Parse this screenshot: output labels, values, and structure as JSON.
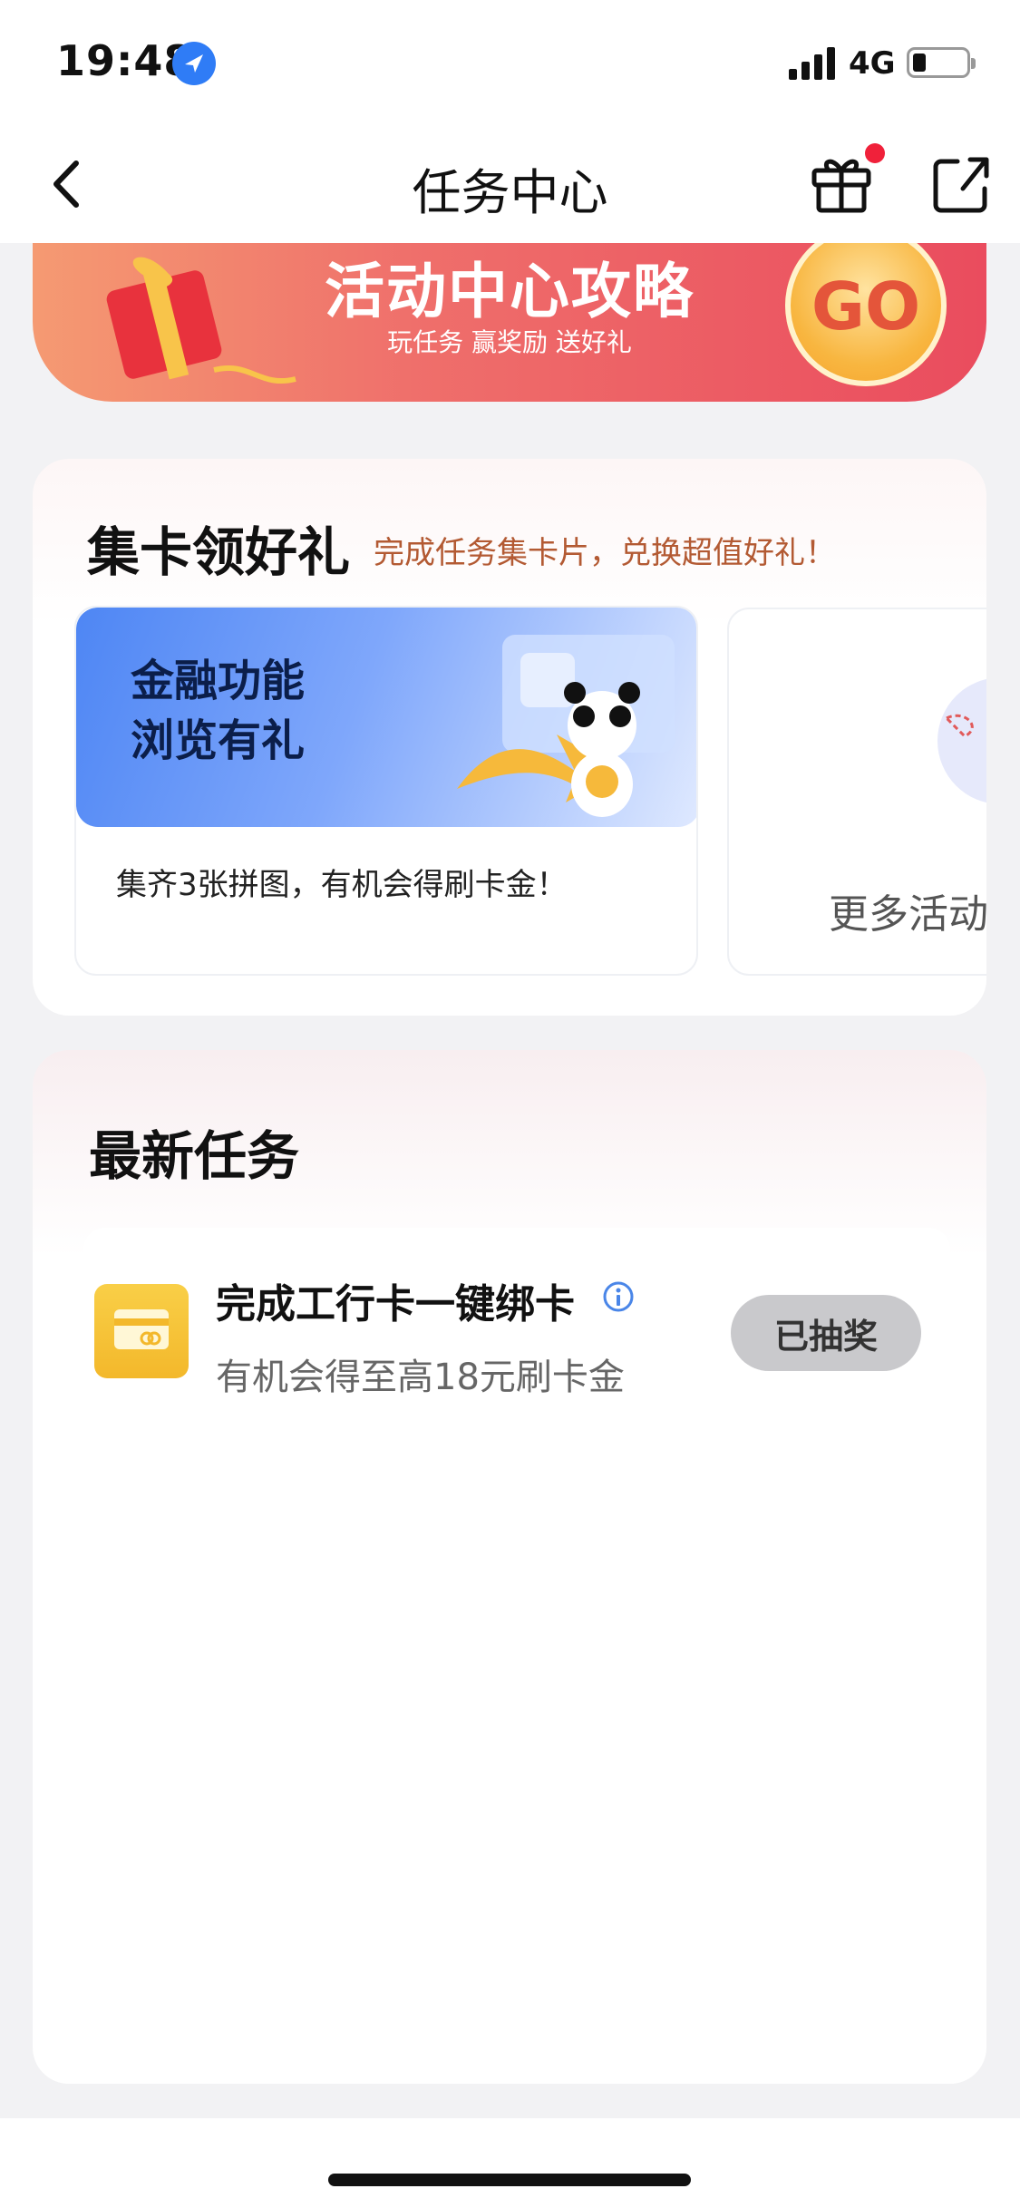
{
  "status_bar": {
    "time": "19:48",
    "network": "4G"
  },
  "nav": {
    "title": "任务中心"
  },
  "banner": {
    "title": "活动中心攻略",
    "subtitle": "玩任务 赢奖励 送好礼",
    "go_label": "GO"
  },
  "collect": {
    "title": "集卡领好礼",
    "subtitle": "完成任务集卡片，兑换超值好礼！",
    "activity": {
      "title_line1": "金融功能",
      "title_line2": "浏览有礼",
      "description": "集齐3张拼图，有机会得刷卡金！"
    },
    "more_label": "更多活动"
  },
  "tasks": {
    "title": "最新任务",
    "items": [
      {
        "title": "完成工行卡一键绑卡",
        "subtitle": "有机会得至高18元刷卡金",
        "button": "已抽奖"
      }
    ]
  },
  "colors": {
    "accent_red": "#ea4c5e",
    "task_icon": "#f3b82b",
    "button_disabled": "#c9c9cc"
  }
}
